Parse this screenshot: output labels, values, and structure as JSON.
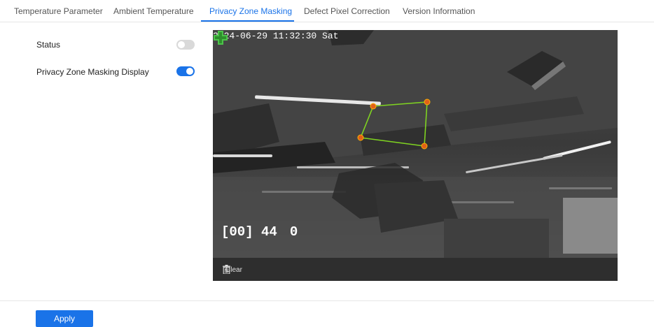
{
  "tabs": [
    {
      "label": "Temperature Parameter",
      "active": false
    },
    {
      "label": "Ambient Temperature",
      "active": false
    },
    {
      "label": "Privacy Zone Masking",
      "active": true
    },
    {
      "label": "Defect Pixel Correction",
      "active": false
    },
    {
      "label": "Version Information",
      "active": false
    }
  ],
  "settings": {
    "status": {
      "label": "Status",
      "enabled": false
    },
    "display": {
      "label": "Privacy Zone Masking Display",
      "enabled": true
    }
  },
  "video": {
    "timestamp": "2024-06-29 11:32:30 Sat",
    "channel_osd": "[00] 44",
    "channel_osd_suffix": "0",
    "clear_label": "Clear"
  },
  "footer": {
    "apply_label": "Apply"
  },
  "colors": {
    "accent": "#1a73e8",
    "mask_outline": "#7fd321",
    "mask_handle": "#e0601a"
  }
}
